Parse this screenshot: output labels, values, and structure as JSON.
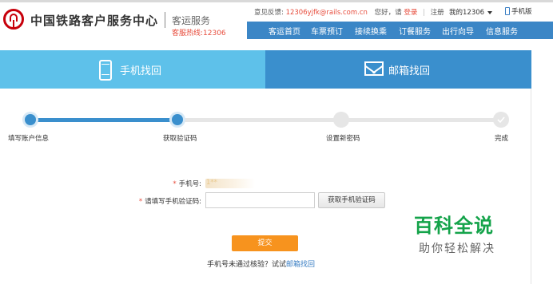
{
  "header": {
    "brand_title": "中国铁路客户服务中心",
    "brand_subtitle": "客运服务",
    "hotline": "客服热线:12306",
    "feedback_label": "意见反馈:",
    "feedback_email": "12306yjfk@rails.com.cn",
    "greeting": "您好，请",
    "login": "登录",
    "register": "注册",
    "my_account": "我的12306",
    "mobile": "手机版"
  },
  "nav": {
    "items": [
      "客运首页",
      "车票预订",
      "接续换乘",
      "订餐服务",
      "出行向导",
      "信息服务"
    ]
  },
  "tabs": {
    "phone": "手机找回",
    "email": "邮箱找回"
  },
  "steps": [
    {
      "label": "填写账户信息",
      "state": "done"
    },
    {
      "label": "获取验证码",
      "state": "current"
    },
    {
      "label": "设置新密码",
      "state": "pending"
    },
    {
      "label": "完成",
      "state": "pending"
    }
  ],
  "form": {
    "phone_label": "手机号:",
    "phone_value": "1**",
    "code_label": "请填写手机验证码:",
    "code_value": "",
    "get_code_button": "获取手机验证码",
    "submit": "提交",
    "fallback_prefix": "手机号未通过核验？试试",
    "fallback_link": "邮箱找回"
  },
  "watermark": {
    "title": "百科全说",
    "subtitle": "助你轻松解决"
  },
  "colors": {
    "accent_blue": "#3b86c6",
    "tab_active": "#5ec1ea",
    "step_active": "#3a8fcd",
    "submit_orange": "#f7931e",
    "brand_red": "#c7000b",
    "watermark_green": "#14a34a"
  },
  "icons": [
    "railway-logo-icon",
    "phone-icon",
    "mail-icon",
    "check-icon",
    "caret-down-icon"
  ]
}
